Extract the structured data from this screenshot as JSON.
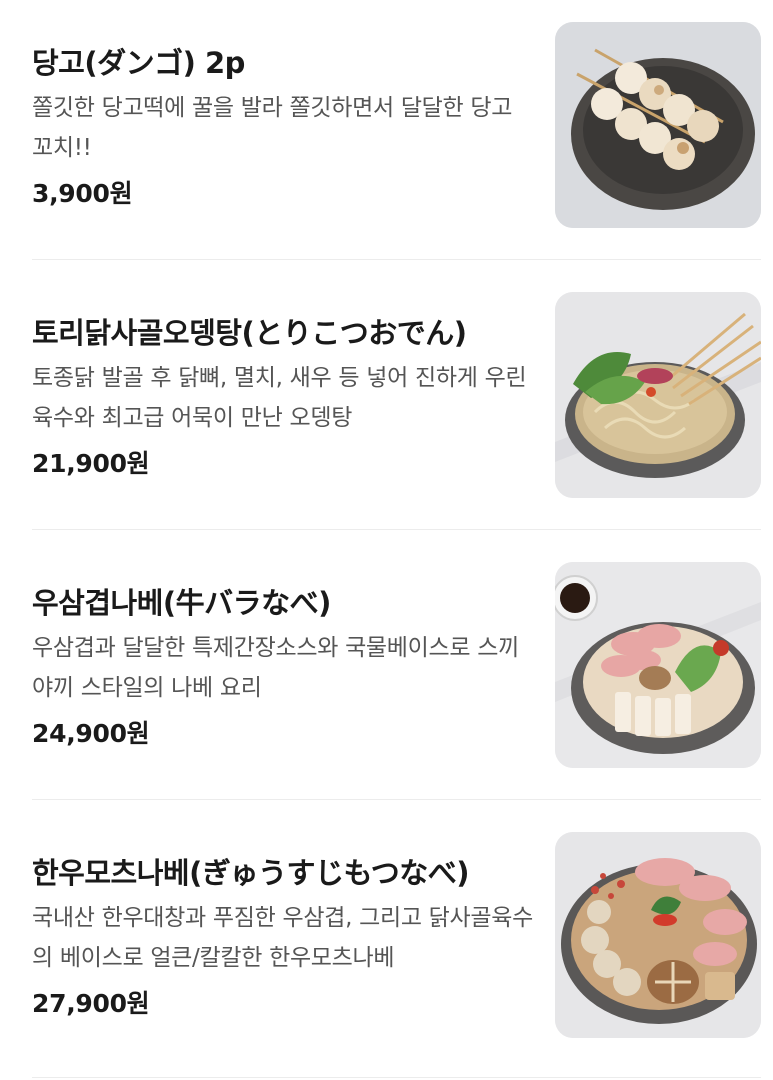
{
  "menu": {
    "items": [
      {
        "name": "당고(ダンゴ) 2p",
        "description": "쫄깃한 당고떡에 꿀을 발라 쫄깃하면서 달달한 당고 꼬치!!",
        "price": "3,900원",
        "image": "dango-skewers-photo"
      },
      {
        "name": "토리닭사골오뎅탕(とりこつおでん)",
        "description": "토종닭 발골 후 닭뼈, 멸치, 새우 등 넣어 진하게 우린 육수와 최고급 어묵이 만난 오뎅탕",
        "price": "21,900원",
        "image": "oden-hotpot-photo"
      },
      {
        "name": "우삼겹나베(牛バラなべ)",
        "description": "우삼겹과 달달한 특제간장소스와 국물베이스로 스끼야끼 스타일의 나베 요리",
        "price": "24,900원",
        "image": "beef-brisket-nabe-photo"
      },
      {
        "name": "한우모츠나베(ぎゅうすじもつなべ)",
        "description": "국내산 한우대창과 푸짐한 우삼겹, 그리고 닭사골육수의 베이스로 얼큰/칼칼한 한우모츠나베",
        "price": "27,900원",
        "image": "motsu-nabe-photo"
      }
    ]
  }
}
